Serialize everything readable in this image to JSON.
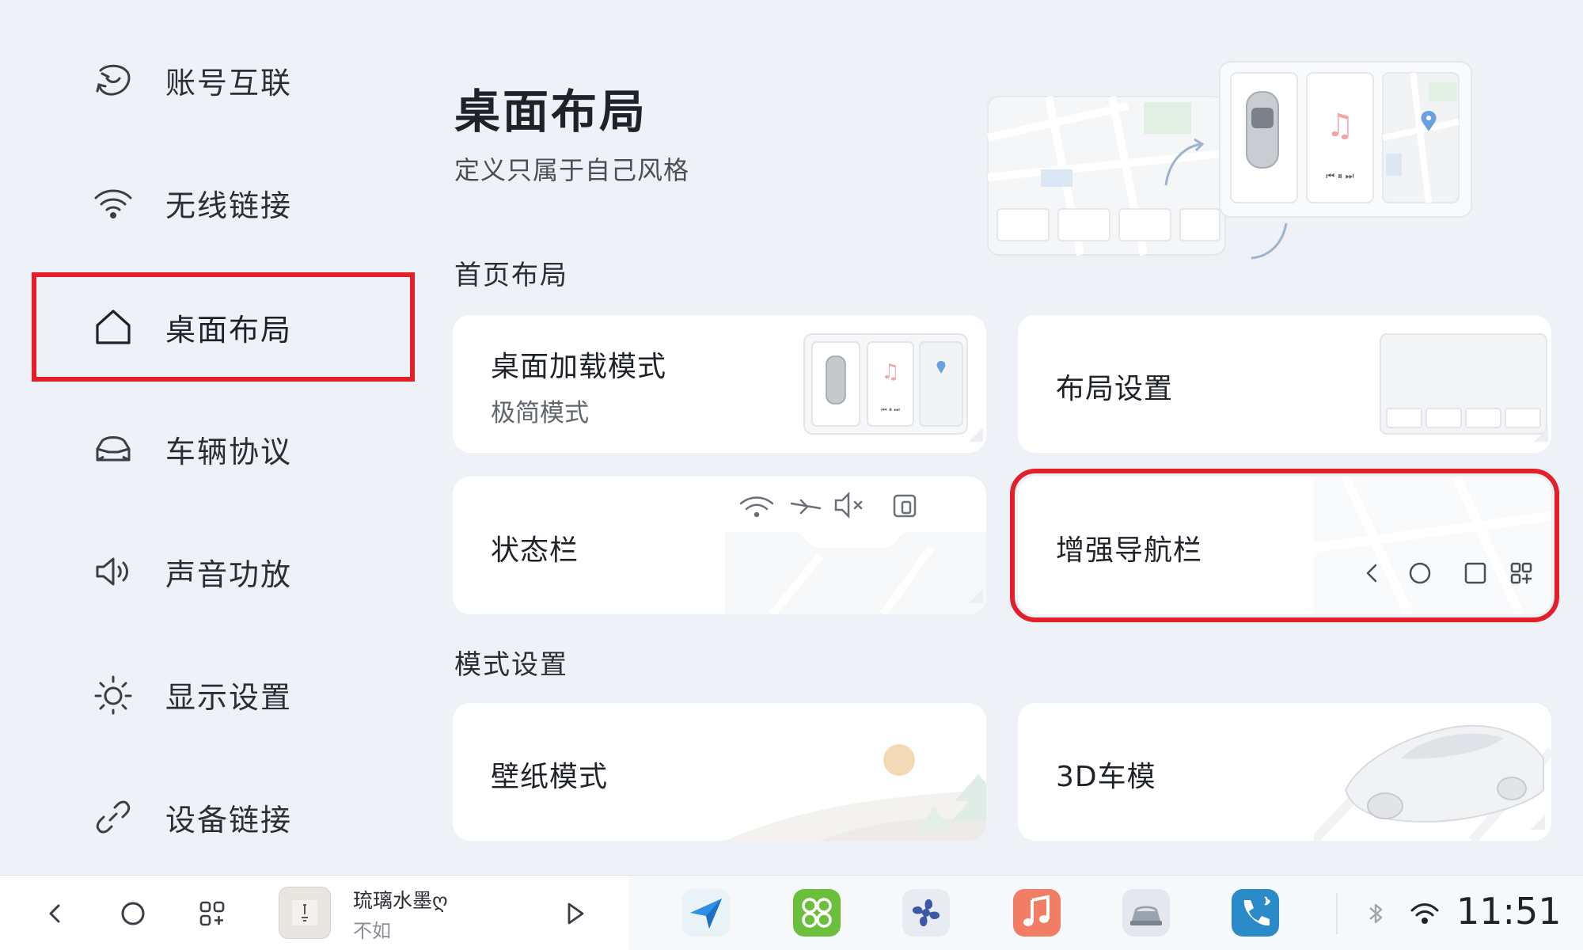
{
  "sidebar": {
    "items": [
      {
        "label": "账号互联",
        "icon": "account-link-icon"
      },
      {
        "label": "无线链接",
        "icon": "wifi-icon"
      },
      {
        "label": "桌面布局",
        "icon": "home-icon",
        "active": true
      },
      {
        "label": "车辆协议",
        "icon": "car-icon"
      },
      {
        "label": "声音功放",
        "icon": "speaker-icon"
      },
      {
        "label": "显示设置",
        "icon": "brightness-icon"
      },
      {
        "label": "设备链接",
        "icon": "chain-link-icon"
      }
    ]
  },
  "header": {
    "title": "桌面布局",
    "subtitle": "定义只属于自己风格"
  },
  "sections": {
    "home_layout": "首页布局",
    "mode_settings": "模式设置"
  },
  "cards": {
    "load_mode": {
      "title": "桌面加载模式",
      "value": "极简模式"
    },
    "layout_settings": {
      "title": "布局设置"
    },
    "status_bar": {
      "title": "状态栏"
    },
    "enhanced_nav": {
      "title": "增强导航栏"
    },
    "wallpaper": {
      "title": "壁纸模式"
    },
    "car_3d": {
      "title": "3D车模"
    }
  },
  "dock": {
    "media_title": "琉璃水墨ღ",
    "media_artist": "不如",
    "clock": "11:51",
    "apps": [
      "navigation-app-icon",
      "widgets-app-icon",
      "fan-app-icon",
      "music-app-icon",
      "car-app-icon",
      "phone-app-icon"
    ]
  },
  "colors": {
    "accent_red": "#e3202a",
    "background": "#eef1f5",
    "card": "#ffffff"
  }
}
